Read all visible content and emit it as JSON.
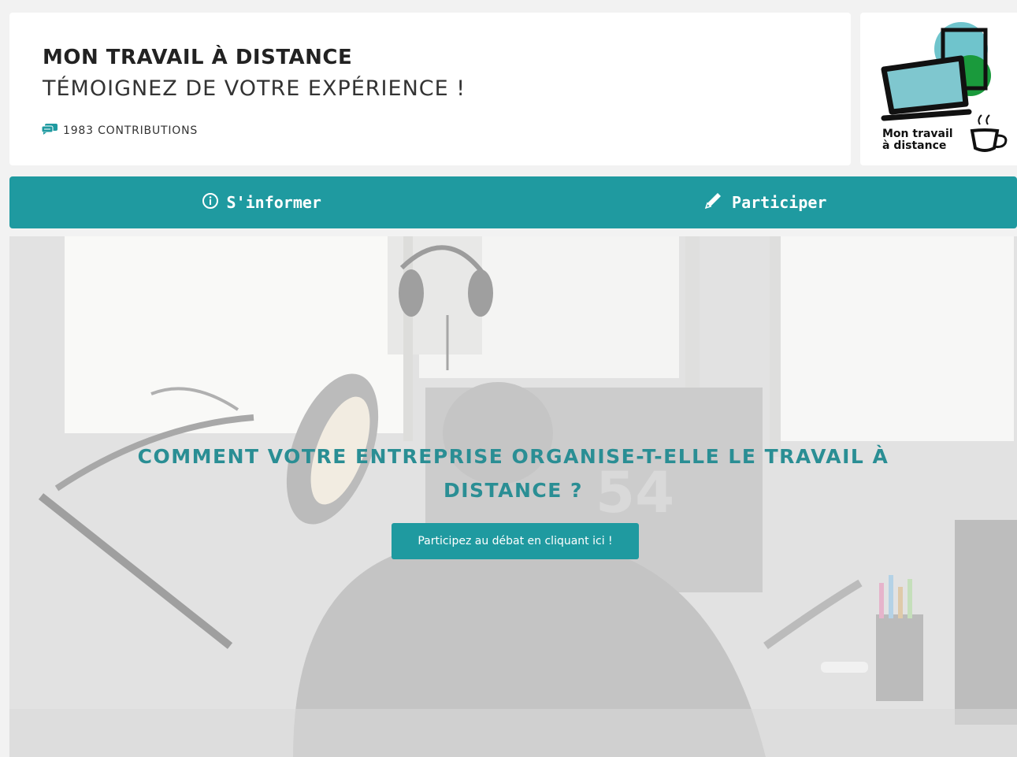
{
  "header": {
    "title": "MON TRAVAIL À DISTANCE",
    "subtitle": "TÉMOIGNEZ DE VOTRE EXPÉRIENCE !",
    "contributions": "1983 CONTRIBUTIONS",
    "contributions_icon": "comments-icon"
  },
  "logo": {
    "line1": "Mon travail",
    "line2": "à  distance"
  },
  "nav": {
    "items": [
      {
        "label": "S'informer",
        "icon": "info-circle-icon"
      },
      {
        "label": "Participer",
        "icon": "pencil-icon"
      }
    ]
  },
  "hero": {
    "title": "COMMENT VOTRE ENTREPRISE ORGANISE-T-ELLE LE TRAVAIL À DISTANCE ?",
    "cta_label": "Participez au débat en cliquant ici !",
    "monitor_number": "54"
  },
  "colors": {
    "accent": "#1f9aa0",
    "hero_title": "#2a8e94",
    "logo_teal": "#6fc4cc",
    "logo_green": "#1a9a3c"
  }
}
